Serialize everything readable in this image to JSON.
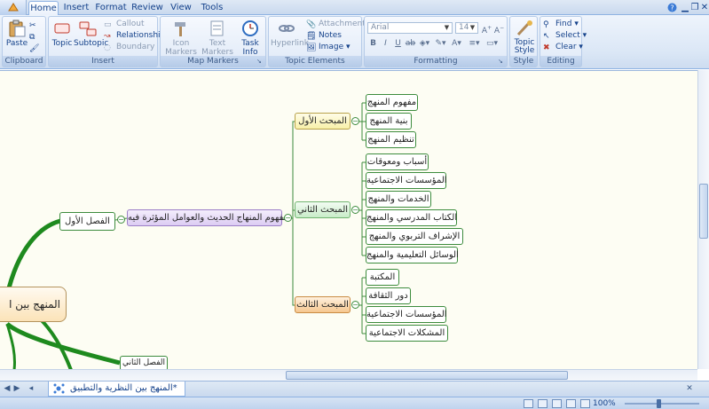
{
  "ribbon": {
    "tabs": [
      "Home",
      "Insert",
      "Format",
      "Review",
      "View",
      "Tools"
    ],
    "groups": {
      "clipboard": "Clipboard",
      "insert": "Insert",
      "map_markers": "Map Markers",
      "topic_elements": "Topic Elements",
      "formatting": "Formatting",
      "style": "Style",
      "editing": "Editing"
    },
    "buttons": {
      "paste": "Paste",
      "topic": "Topic",
      "subtopic": "Subtopic",
      "callout": "Callout",
      "relationship": "Relationship",
      "boundary": "Boundary",
      "icon_markers": "Icon Markers",
      "text_markers": "Text Markers",
      "task_info": "Task Info",
      "hyperlink": "Hyperlink",
      "attachment": "Attachment",
      "notes": "Notes",
      "image": "Image",
      "topic_style": "Topic Style",
      "find": "Find",
      "select": "Select",
      "clear": "Clear"
    },
    "font": {
      "family": "Arial",
      "size": "14"
    },
    "format_buttons": [
      "B",
      "I",
      "U"
    ]
  },
  "map": {
    "root": "المنهج بين ا",
    "level1": [
      "الفصل الأول",
      "الفصل الثاني"
    ],
    "chapter1_topic": "مفهوم المنهاج الحديث والعوامل المؤثرة فيه",
    "sections": [
      {
        "label": "المبحث الأول",
        "items": [
          "مفهوم المنهج",
          "بنية المنهج",
          "تنظيم المنهج"
        ]
      },
      {
        "label": "المبحث الثاني",
        "items": [
          "أسباب ومعوقات",
          "المؤسسات الاجتماعية",
          "الخدمات والمنهج",
          "الكتاب المدرسي والمنهج",
          "الإشراف التربوي والمنهج",
          "الوسائل التعليمية والمنهج"
        ]
      },
      {
        "label": "المبحث الثالث",
        "items": [
          "المكتبة",
          "دور الثقافة",
          "المؤسسات الاجتماعية",
          "المشكلات الاجتماعية"
        ]
      }
    ],
    "collapse_symbol": "−"
  },
  "sheet_tab": "المنهج بين النظرية والتطبيق*",
  "status": {
    "zoom": "100%"
  },
  "colors": {
    "branch_main": "#1e8a1e",
    "branch_thin": "#3d8c3d",
    "accent": "#15428b"
  }
}
